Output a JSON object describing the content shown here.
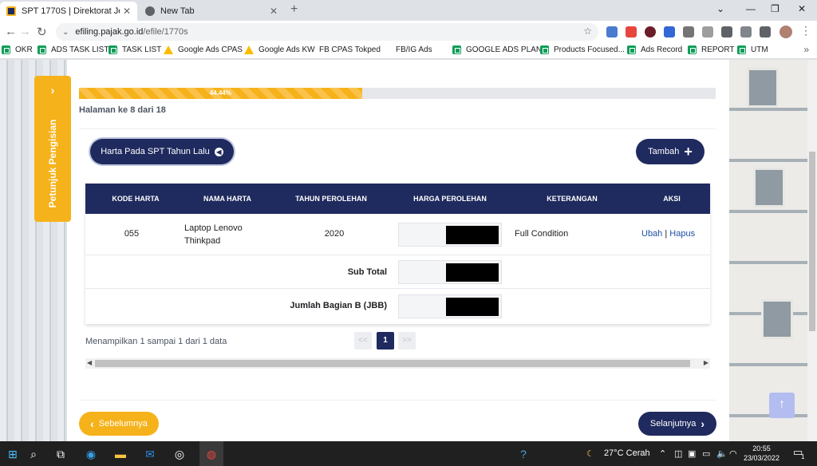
{
  "browser": {
    "tabs": [
      {
        "title": "SPT 1770S | Direktorat Jenderal P",
        "close": "✕"
      },
      {
        "title": "New Tab",
        "close": "✕"
      }
    ],
    "new_tab": "+",
    "window_controls": {
      "minimize": "⌄",
      "restore": "—",
      "maximize": "❐",
      "close": "✕"
    },
    "url_host": "efiling.pajak.go.id",
    "url_path": "/efile/1770s",
    "bookmarks": [
      {
        "label": "OKR",
        "icon": "sheet"
      },
      {
        "label": "ADS TASK LIST",
        "icon": "sheet"
      },
      {
        "label": "TASK LIST",
        "icon": "sheet"
      },
      {
        "label": "Google Ads CPAS",
        "icon": "ads"
      },
      {
        "label": "Google Ads KW",
        "icon": "ads"
      },
      {
        "label": "FB CPAS Tokped",
        "icon": "page"
      },
      {
        "label": "FB/IG Ads",
        "icon": "page"
      },
      {
        "label": "GOOGLE ADS PLAN",
        "icon": "sheet"
      },
      {
        "label": "Products Focused...",
        "icon": "sheet"
      },
      {
        "label": "Ads Record",
        "icon": "sheet"
      },
      {
        "label": "REPORT",
        "icon": "sheet"
      },
      {
        "label": "UTM",
        "icon": "sheet"
      }
    ],
    "bookmarks_more": "»"
  },
  "page": {
    "side_tab": {
      "label": "Petunjuk Pengisian",
      "chevron": "›"
    },
    "progress": {
      "percent": 44.44,
      "label": "44.44%"
    },
    "page_indicator": "Halaman ke 8 dari 18",
    "btn_harta_label": "Harta Pada SPT Tahun Lalu",
    "btn_tambah_label": "Tambah",
    "table": {
      "columns": [
        "KODE HARTA",
        "NAMA HARTA",
        "TAHUN PEROLEHAN",
        "HARGA PEROLEHAN",
        "KETERANGAN",
        "AKSI"
      ],
      "rows": [
        {
          "kode": "055",
          "nama_line1": "Laptop Lenovo",
          "nama_line2": "Thinkpad",
          "tahun": "2020",
          "keterangan": "Full Condition",
          "ubah": "Ubah",
          "sep": "|",
          "hapus": "Hapus"
        }
      ],
      "subtotal_label": "Sub Total",
      "jbb_label": "Jumlah Bagian B (JBB)"
    },
    "showing": "Menampilkan 1 sampai 1 dari 1 data",
    "pager": {
      "prev": "<<",
      "current": "1",
      "next": ">>"
    },
    "btn_prev_label": "Sebelumnya",
    "btn_next_label": "Selanjutnya",
    "back_to_top": "↑"
  },
  "taskbar": {
    "weather": "27°C  Cerah",
    "time": "20:55",
    "date": "23/03/2022",
    "notifications": "1"
  }
}
